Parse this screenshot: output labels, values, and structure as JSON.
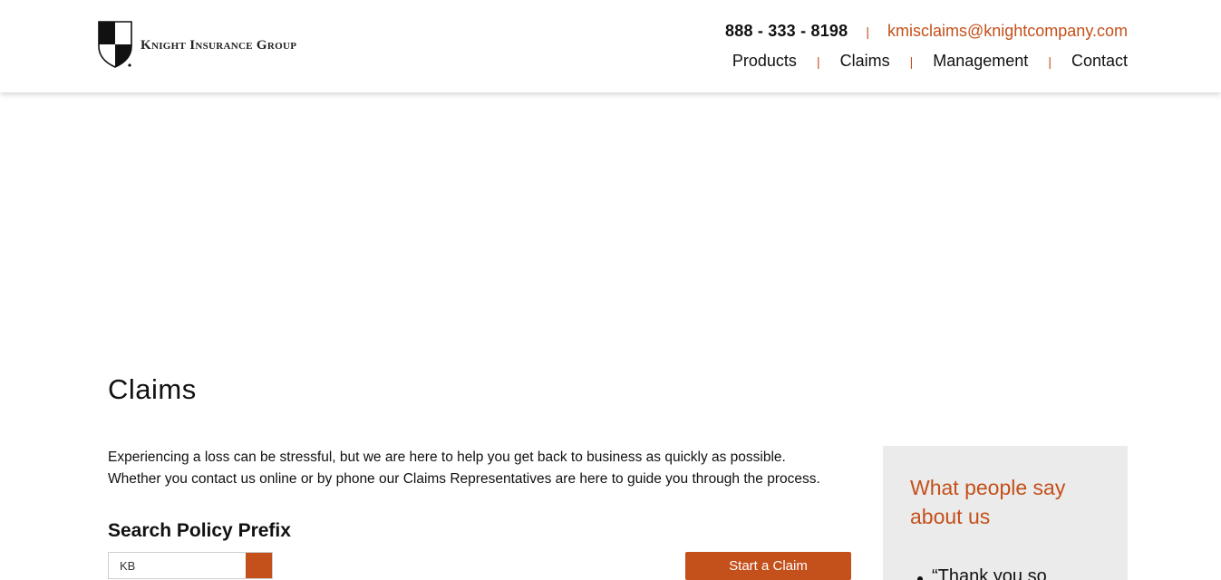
{
  "header": {
    "logo_text": "Knight Insurance Group",
    "phone": "888 - 333 - 8198",
    "email": "kmisclaims@knightcompany.com",
    "nav": [
      "Products",
      "Claims",
      "Management",
      "Contact"
    ]
  },
  "main": {
    "title": "Claims",
    "intro_line1": "Experiencing a loss can be stressful, but we are here to help you get back to business as quickly as possible.",
    "intro_line2": "Whether you contact us online or by phone our Claims Representatives are here to guide you through the process.",
    "search_heading": "Search Policy Prefix",
    "search_value": "KB",
    "start_claim_label": "Start a Claim"
  },
  "sidebar": {
    "title": "What people say about us",
    "testimonial_1": "“Thank you so"
  },
  "colors": {
    "accent": "#c4501b",
    "sidebar_bg": "#ebebeb"
  }
}
